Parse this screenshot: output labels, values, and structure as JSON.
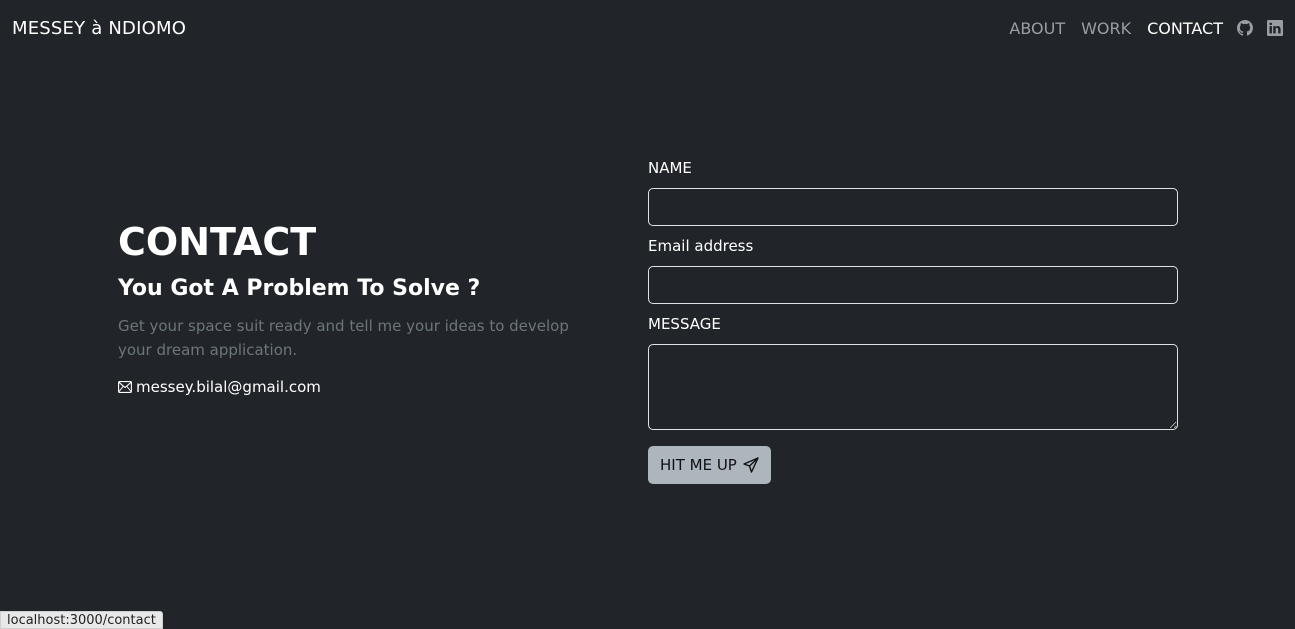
{
  "navbar": {
    "brand": "MESSEY à NDIOMO",
    "links": [
      {
        "label": "ABOUT",
        "active": false
      },
      {
        "label": "WORK",
        "active": false
      },
      {
        "label": "CONTACT",
        "active": true
      }
    ],
    "icons": [
      "github-icon",
      "linkedin-icon"
    ]
  },
  "contact": {
    "title": "CONTACT",
    "subtitle": "You Got A Problem To Solve ?",
    "description": "Get your space suit ready and tell me your ideas to develop your dream application.",
    "email": "messey.bilal@gmail.com"
  },
  "form": {
    "name_label": "NAME",
    "name_value": "",
    "email_label": "Email address",
    "email_value": "",
    "message_label": "MESSAGE",
    "message_value": "",
    "submit_label": "HIT ME UP"
  },
  "statusbar": {
    "url": "localhost:3000/contact"
  },
  "colors": {
    "background": "#212529",
    "muted_text": "#6c757d",
    "button_bg": "#adb5bd"
  }
}
